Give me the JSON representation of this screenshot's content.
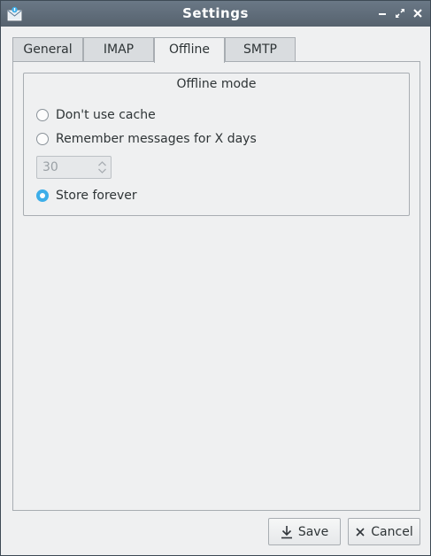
{
  "window": {
    "title": "Settings",
    "app_icon": "mail-envelope-icon",
    "controls": [
      "minimize-icon",
      "maximize-icon",
      "close-icon"
    ]
  },
  "tabs": [
    {
      "label": "General",
      "active": false
    },
    {
      "label": "IMAP",
      "active": false
    },
    {
      "label": "Offline",
      "active": true
    },
    {
      "label": "SMTP",
      "active": false
    }
  ],
  "offline": {
    "group_title": "Offline mode",
    "options": [
      {
        "label": "Don't use cache",
        "checked": false
      },
      {
        "label": "Remember messages for X days",
        "checked": false
      },
      {
        "label": "Store forever",
        "checked": true
      }
    ],
    "days": {
      "value": "30",
      "enabled": false
    }
  },
  "buttons": {
    "save": "Save",
    "save_icon": "download-icon",
    "cancel": "Cancel",
    "cancel_icon": "close-icon"
  },
  "colors": {
    "titlebar": "#5f6b77",
    "accent": "#3daee9",
    "background": "#eff0f1"
  }
}
